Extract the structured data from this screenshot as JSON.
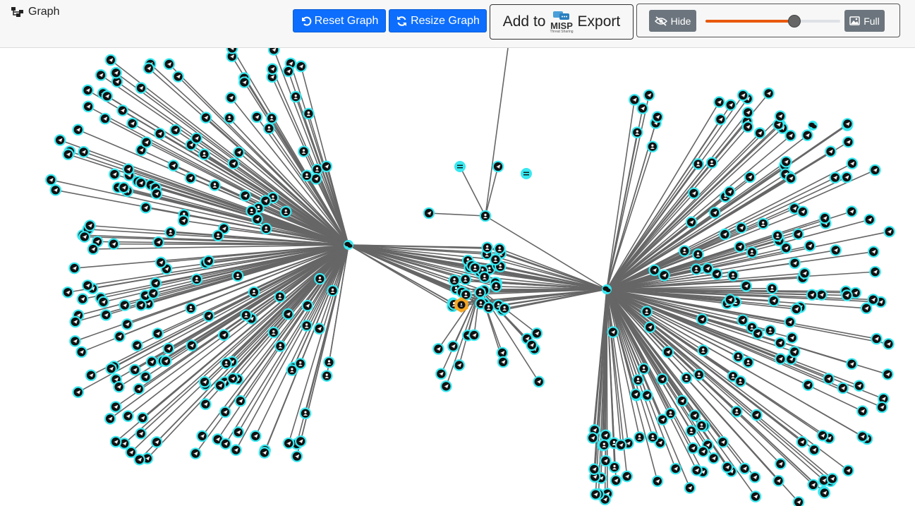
{
  "header": {
    "title": "Graph",
    "reset_label": "Reset Graph",
    "resize_label": "Resize Graph",
    "misp_prefix": "Add to",
    "misp_logo": "MISP",
    "misp_logo_sub": "Threat Sharing",
    "misp_suffix": "Export"
  },
  "controls": {
    "hide_label": "Hide",
    "full_label": "Full",
    "slider_value": 0.66
  },
  "colors": {
    "primary": "#0d6efd",
    "secondary": "#6c757d",
    "slider_accent": "#e8590c",
    "node_ring": "#38e8f0",
    "node_fill": "#111111",
    "edge": "#666666",
    "highlight_node": "#f5a623"
  },
  "graph": {
    "hub_left_icon": "group-chat-icon",
    "hub_right_icon": "group-chat-icon",
    "leaf_icon": "telegram-icon",
    "user_icon": "user-icon",
    "highlight_icon": "user-hexagon-icon",
    "equals_icon": "equals-icon"
  }
}
